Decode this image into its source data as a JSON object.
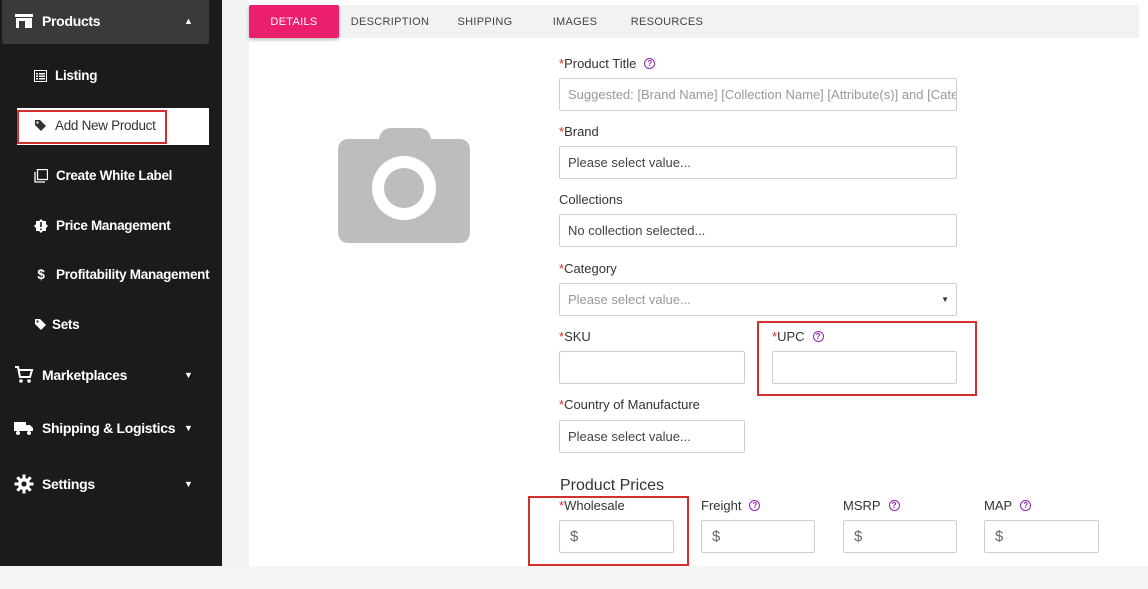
{
  "sidebar": {
    "products_label": "Products",
    "sub_items": [
      {
        "label": "Listing",
        "icon": "list-icon"
      },
      {
        "label": "Add New Product",
        "icon": "tag-icon"
      },
      {
        "label": "Create White Label",
        "icon": "copy-icon"
      },
      {
        "label": "Price Management",
        "icon": "badge-alert-icon"
      },
      {
        "label": "Profitability Management",
        "icon": "dollar-icon"
      },
      {
        "label": "Sets",
        "icon": "tag-icon"
      }
    ],
    "sections": [
      {
        "label": "Marketplaces",
        "icon": "cart-icon"
      },
      {
        "label": "Shipping & Logistics",
        "icon": "truck-icon"
      },
      {
        "label": "Settings",
        "icon": "gear-icon"
      }
    ]
  },
  "tabs": [
    "DETAILS",
    "DESCRIPTION",
    "SHIPPING",
    "IMAGES",
    "RESOURCES"
  ],
  "form": {
    "required_mark": "*",
    "product_title": {
      "label": "Product Title",
      "placeholder": "Suggested: [Brand Name] [Collection Name] [Attribute(s)] and [Category]"
    },
    "brand": {
      "label": "Brand",
      "value": "Please select value..."
    },
    "collections": {
      "label": "Collections",
      "value": "No collection selected..."
    },
    "category": {
      "label": "Category",
      "value": "Please select value..."
    },
    "sku": {
      "label": "SKU",
      "value": ""
    },
    "upc": {
      "label": "UPC",
      "value": ""
    },
    "country": {
      "label": "Country of Manufacture",
      "value": "Please select value..."
    },
    "prices_title": "Product Prices",
    "prices": [
      {
        "label": "Wholesale",
        "required": true,
        "currency": "$"
      },
      {
        "label": "Freight",
        "required": false,
        "currency": "$"
      },
      {
        "label": "MSRP",
        "required": false,
        "currency": "$"
      },
      {
        "label": "MAP",
        "required": false,
        "currency": "$"
      }
    ]
  },
  "colors": {
    "accent": "#ec1f6e",
    "sidebar_bg": "#1b1b1b",
    "highlight": "#d32f2f",
    "help": "#8e24aa"
  }
}
